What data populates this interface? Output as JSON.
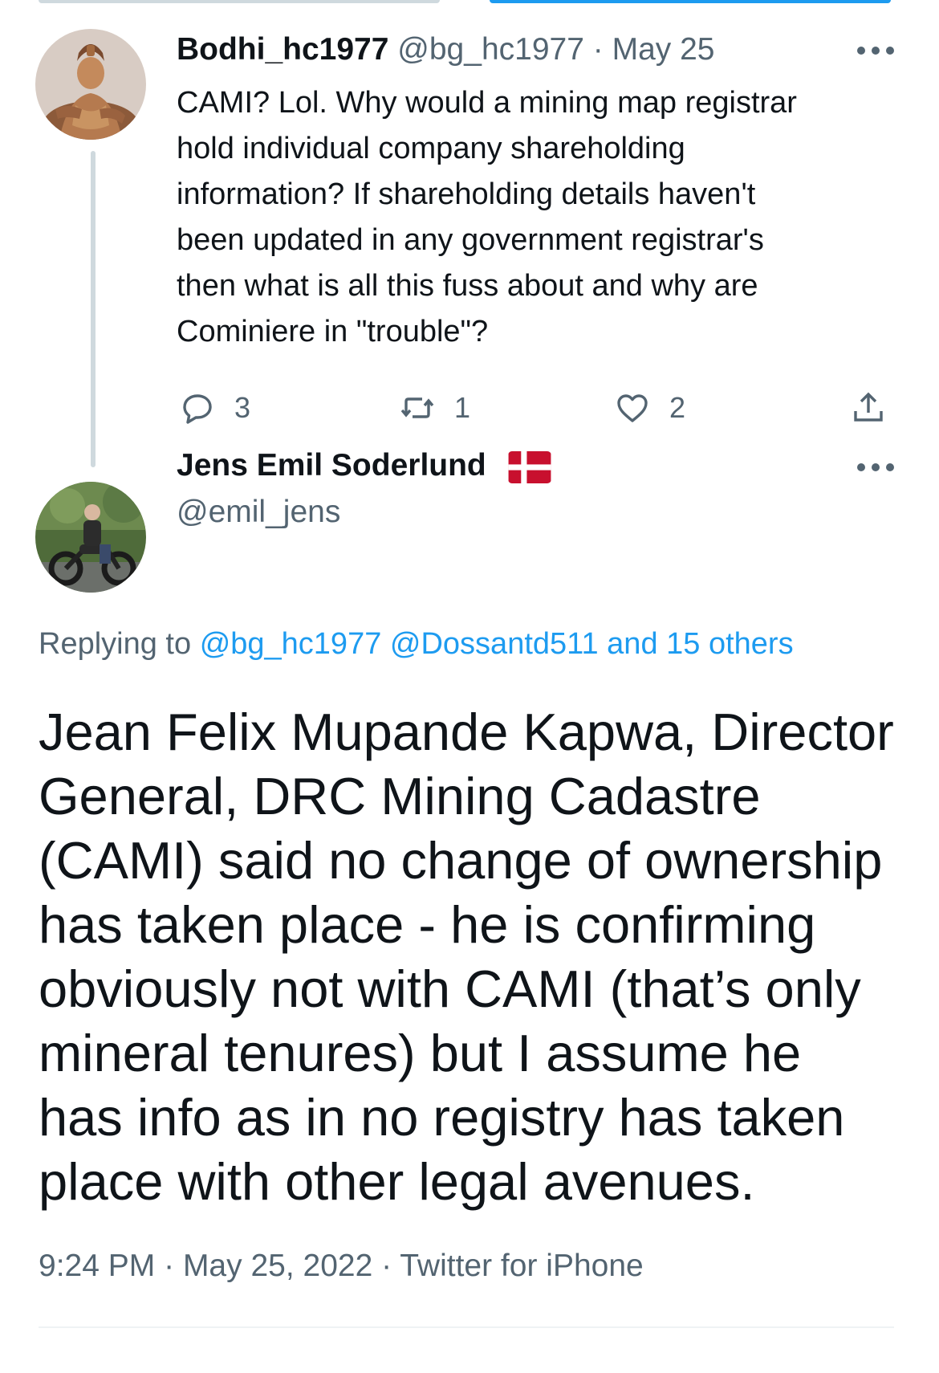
{
  "tweet1": {
    "display_name": "Bodhi_hc1977",
    "handle": "@bg_hc1977",
    "separator": "·",
    "date": "May 25",
    "text": "CAMI? Lol. Why would a mining map registrar\nhold individual company shareholding\ninformation? If shareholding details haven't\nbeen updated in any government registrar's\nthen what is all this fuss about and why are\nCominiere in \"trouble\"?",
    "reply_count": "3",
    "retweet_count": "1",
    "like_count": "2"
  },
  "tweet2": {
    "display_name": "Jens Emil Soderlund",
    "handle": "@emil_jens",
    "replying_prefix": "Replying to",
    "replying_handle1": "@bg_hc1977",
    "replying_handle2": "@Dossantd511",
    "replying_others": "and 15 others",
    "text": "Jean Felix Mupande Kapwa, Director\nGeneral, DRC Mining Cadastre\n(CAMI) said no change of ownership\nhas taken place - he is confirming\nobviously not with CAMI (that’s only\nmineral tenures) but I assume he\nhas info as in no registry has taken\nplace with other legal avenues.",
    "time": "9:24 PM",
    "separator": "·",
    "date": "May 25, 2022",
    "source": "Twitter for iPhone"
  },
  "icons": {
    "more": "more-horizontal-icon",
    "reply": "reply-bubble-icon",
    "retweet": "retweet-icon",
    "like": "heart-icon",
    "share": "share-icon",
    "flag": "denmark-flag-icon"
  },
  "colors": {
    "link": "#1d9bf0",
    "muted": "#536471",
    "text": "#0f1419",
    "thread_line": "#cfd9de",
    "flag_red": "#c8102e"
  }
}
